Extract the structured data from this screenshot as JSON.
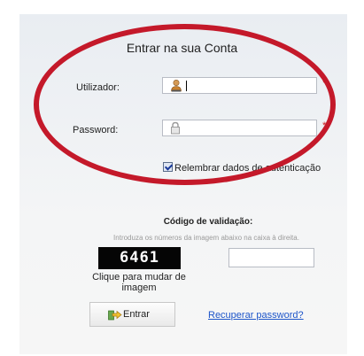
{
  "login": {
    "title": "Entrar na sua Conta",
    "user_label": "Utilizador:",
    "password_label": "Password:",
    "required_marker": "*",
    "remember_label": "Relembrar dados de autenticação",
    "remember_checked": true
  },
  "validation": {
    "title": "Código de validação:",
    "instructions": "Introduza os números da imagem abaixo na caixa à direita.",
    "captcha_code": "6461",
    "change_image_line1": "Clique para mudar de",
    "change_image_line2": "imagem"
  },
  "actions": {
    "submit_label": "Entrar",
    "recover_link": "Recuperar password?"
  },
  "colors": {
    "highlight_oval": "#c4192a",
    "link": "#1d55c9",
    "required": "#cc2222"
  },
  "icons": [
    "user-icon",
    "lock-icon",
    "enter-arrow-icon"
  ]
}
